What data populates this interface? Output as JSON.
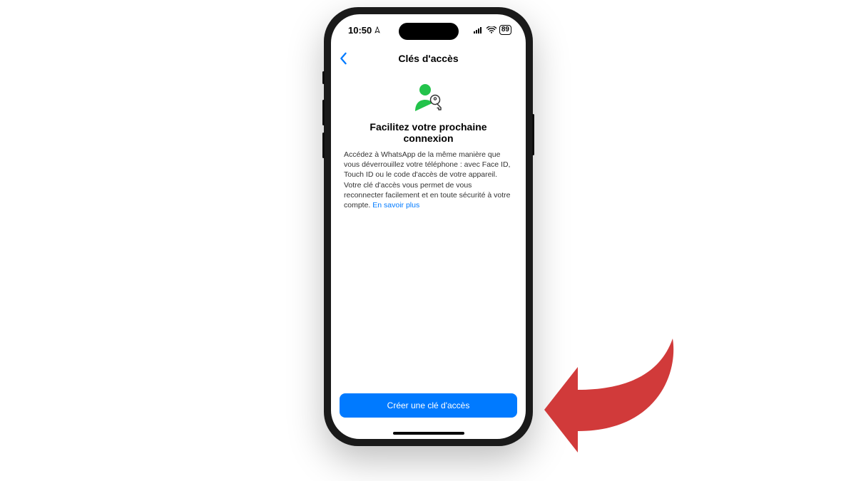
{
  "status": {
    "time": "10:50",
    "battery": "89"
  },
  "nav": {
    "title": "Clés d'accès"
  },
  "hero": {
    "headline": "Facilitez votre prochaine connexion",
    "body": "Accédez à WhatsApp de la même manière que vous déverrouillez votre téléphone : avec Face ID, Touch ID ou le code d'accès de votre appareil. Votre clé d'accès vous permet de vous reconnecter facilement et en toute sécurité à votre compte. ",
    "learn_more": "En savoir plus"
  },
  "cta": {
    "create": "Créer une clé d'accès"
  },
  "colors": {
    "accent_blue": "#007aff",
    "icon_green": "#23c34b",
    "arrow_red": "#d13a3a"
  },
  "icons": {
    "back": "chevron-left-icon",
    "hero": "person-key-icon",
    "navigation": "navigation-icon",
    "signal": "cellular-signal-icon",
    "wifi": "wifi-icon",
    "battery": "battery-icon"
  }
}
